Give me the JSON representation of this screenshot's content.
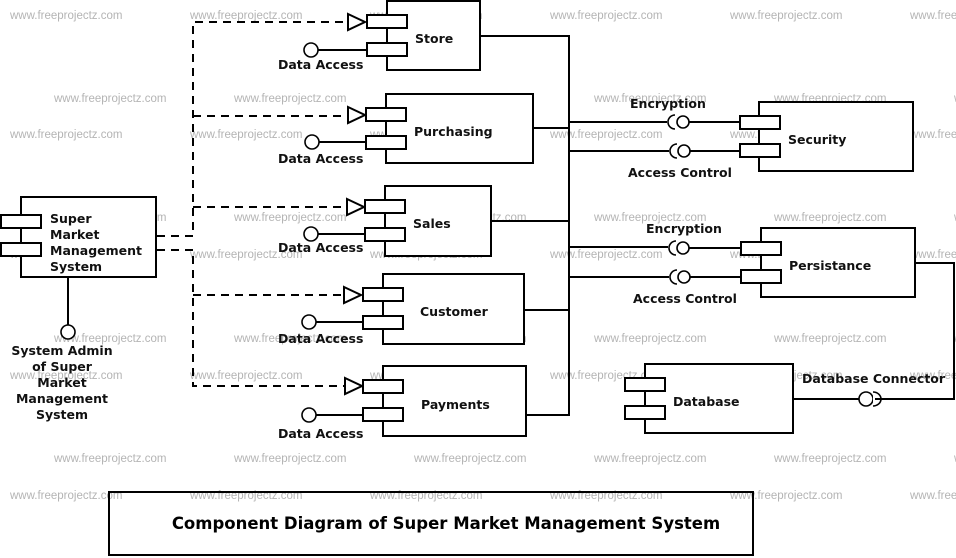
{
  "watermark": "www.freeprojectz.com",
  "title": "Component Diagram of Super Market Management System",
  "actor_component": {
    "label_lines": [
      "Super",
      "Market",
      "Management",
      "System"
    ],
    "interface_label_lines": [
      "System Admin",
      "of Super",
      "Market",
      "Management",
      "System"
    ]
  },
  "components": [
    {
      "id": "store",
      "label": "Store",
      "provided_interface": "Data Access"
    },
    {
      "id": "purchasing",
      "label": "Purchasing",
      "provided_interface": "Data Access"
    },
    {
      "id": "sales",
      "label": "Sales",
      "provided_interface": "Data Access"
    },
    {
      "id": "customer",
      "label": "Customer",
      "provided_interface": "Data Access"
    },
    {
      "id": "payments",
      "label": "Payments",
      "provided_interface": "Data Access"
    }
  ],
  "services": [
    {
      "id": "security",
      "label": "Security",
      "interfaces": [
        "Encryption",
        "Access Control"
      ]
    },
    {
      "id": "persistance",
      "label": "Persistance",
      "interfaces": [
        "Encryption",
        "Access Control"
      ]
    }
  ],
  "database": {
    "label": "Database",
    "interface": "Database Connector"
  },
  "colors": {
    "stroke": "#000000",
    "background": "#ffffff",
    "watermark": "#b4b4b4"
  }
}
